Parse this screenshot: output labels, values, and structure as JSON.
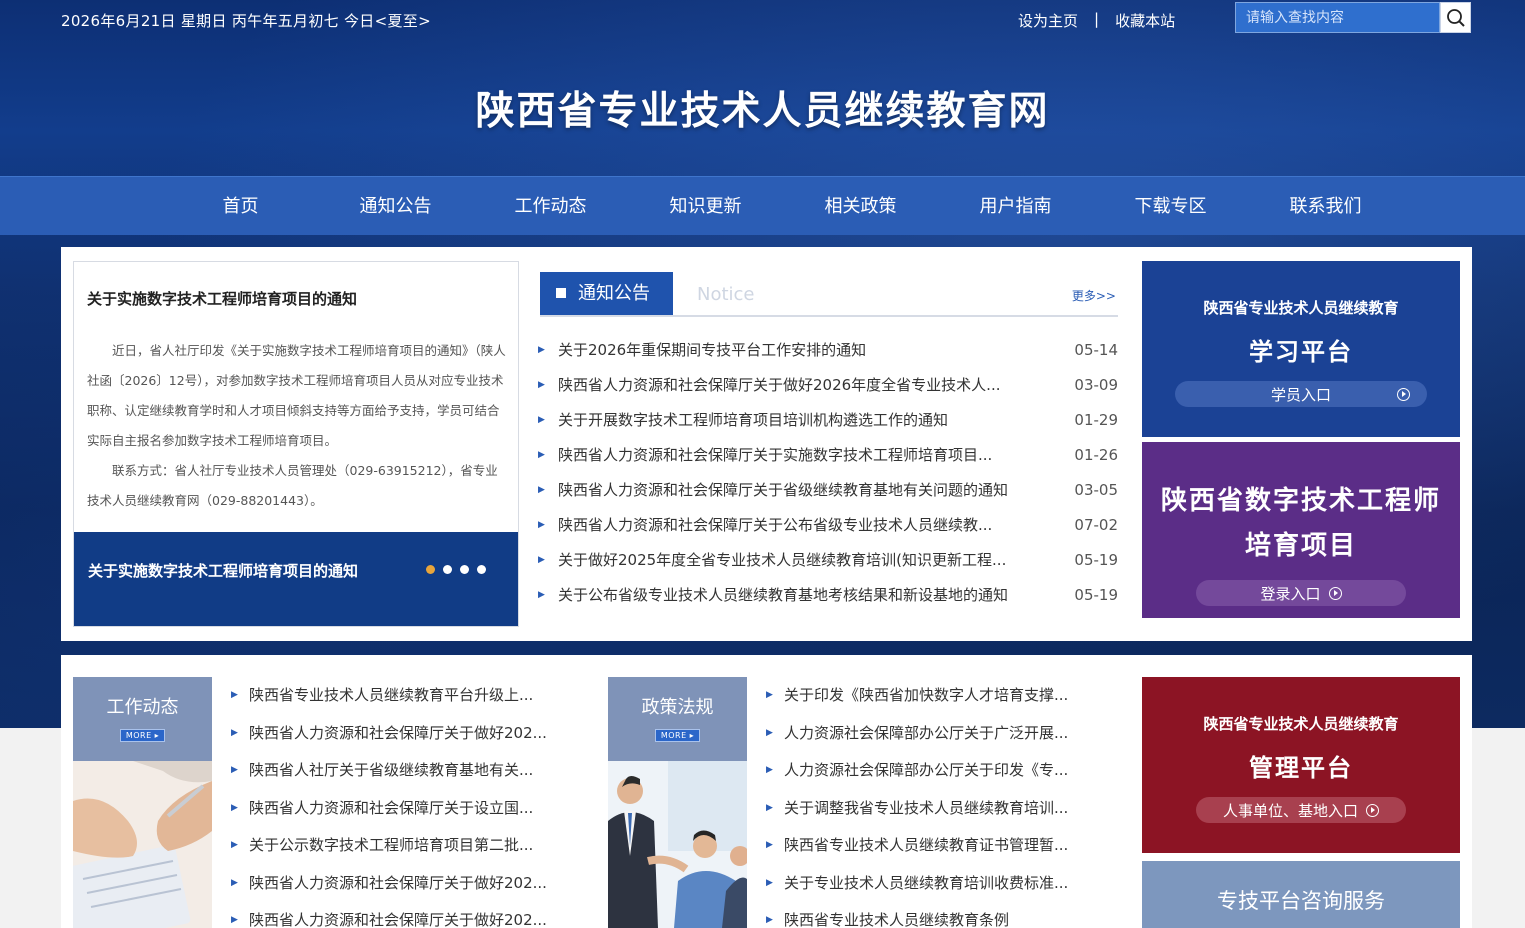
{
  "topbar": {
    "date": "2026年6月21日  星期日  丙午年五月初七  今日<夏至>",
    "set_home": "设为主页",
    "separator": "|",
    "bookmark": "收藏本站",
    "search_placeholder": "请输入查找内容"
  },
  "site_title": "陕西省专业技术人员继续教育网",
  "nav": [
    "首页",
    "通知公告",
    "工作动态",
    "知识更新",
    "相关政策",
    "用户指南",
    "下载专区",
    "联系我们"
  ],
  "feature": {
    "title": "关于实施数字技术工程师培育项目的通知",
    "para1": "近日，省人社厅印发《关于实施数字技术工程师培育项目的通知》（陕人社函〔2026〕12号），对参加数字技术工程师培育项目人员从对应专业技术职称、认定继续教育学时和人才项目倾斜支持等方面给予支持，学员可结合实际自主报名参加数字技术工程师培育项目。",
    "para2": "联系方式：省人社厅专业技术人员管理处（029-63915212），省专业技术人员继续教育网（029-88201443）。",
    "caption": "关于实施数字技术工程师培育项目的通知"
  },
  "notice": {
    "tab": "通知公告",
    "en": "Notice",
    "more": "更多>>",
    "items": [
      {
        "title": "关于2026年重保期间专技平台工作安排的通知",
        "date": "05-14"
      },
      {
        "title": "陕西省人力资源和社会保障厅关于做好2026年度全省专业技术人...",
        "date": "03-09"
      },
      {
        "title": "关于开展数字技术工程师培育项目培训机构遴选工作的通知",
        "date": "01-29"
      },
      {
        "title": "陕西省人力资源和社会保障厅关于实施数字技术工程师培育项目...",
        "date": "01-26"
      },
      {
        "title": "陕西省人力资源和社会保障厅关于省级继续教育基地有关问题的通知",
        "date": "03-05"
      },
      {
        "title": "陕西省人力资源和社会保障厅关于公布省级专业技术人员继续教...",
        "date": "07-02"
      },
      {
        "title": "关于做好2025年度全省专业技术人员继续教育培训(知识更新工程...",
        "date": "05-19"
      },
      {
        "title": "关于公布省级专业技术人员继续教育基地考核结果和新设基地的通知",
        "date": "05-19"
      }
    ]
  },
  "learn_platform": {
    "sub": "陕西省专业技术人员继续教育",
    "main": "学习平台",
    "button": "学员入口"
  },
  "digital_platform": {
    "main1": "陕西省数字技术工程师",
    "main2": "培育项目",
    "button": "登录入口"
  },
  "manage_platform": {
    "sub": "陕西省专业技术人员继续教育",
    "main": "管理平台",
    "button": "人事单位、基地入口"
  },
  "consult": "专技平台咨询服务",
  "work_news": {
    "title": "工作动态",
    "more": "MORE ▸",
    "items": [
      "陕西省专业技术人员继续教育平台升级上...",
      "陕西省人力资源和社会保障厅关于做好202...",
      "陕西省人社厅关于省级继续教育基地有关...",
      "陕西省人力资源和社会保障厅关于设立国...",
      "关于公示数字技术工程师培育项目第二批...",
      "陕西省人力资源和社会保障厅关于做好202...",
      "陕西省人力资源和社会保障厅关于做好202..."
    ]
  },
  "policy": {
    "title": "政策法规",
    "more": "MORE ▸",
    "items": [
      "关于印发《陕西省加快数字人才培育支撑...",
      "人力资源社会保障部办公厅关于广泛开展...",
      "人力资源社会保障部办公厅关于印发《专...",
      "关于调整我省专业技术人员继续教育培训...",
      "陕西省专业技术人员继续教育证书管理暂...",
      "关于专业技术人员继续教育培训收费标准...",
      "陕西省专业技术人员继续教育条例"
    ]
  }
}
